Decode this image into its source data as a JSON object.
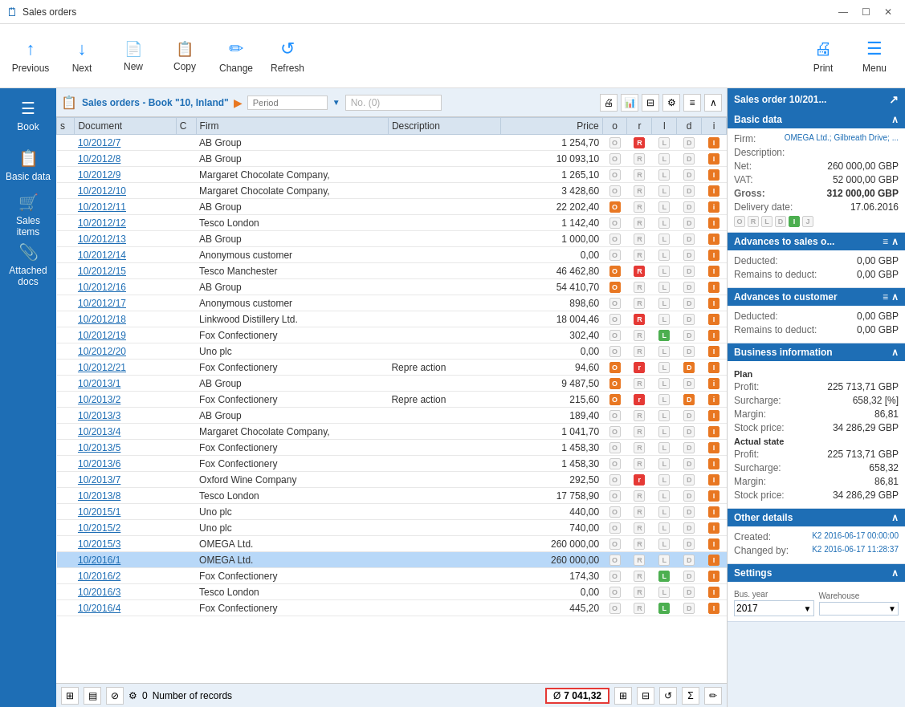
{
  "titleBar": {
    "title": "Sales orders",
    "controls": [
      "minimize",
      "maximize",
      "close"
    ]
  },
  "toolbar": {
    "buttons": [
      {
        "id": "previous",
        "label": "Previous",
        "icon": "↑"
      },
      {
        "id": "next",
        "label": "Next",
        "icon": "↓"
      },
      {
        "id": "new",
        "label": "New",
        "icon": "📄"
      },
      {
        "id": "copy",
        "label": "Copy",
        "icon": "📋"
      },
      {
        "id": "change",
        "label": "Change",
        "icon": "✏"
      },
      {
        "id": "refresh",
        "label": "Refresh",
        "icon": "↺"
      }
    ],
    "rightButtons": [
      {
        "id": "print",
        "label": "Print",
        "icon": "🖨"
      },
      {
        "id": "menu",
        "label": "Menu",
        "icon": "☰"
      }
    ]
  },
  "sidebar": {
    "items": [
      {
        "id": "book",
        "label": "Book",
        "icon": "☰"
      },
      {
        "id": "basic-data",
        "label": "Basic data",
        "icon": "📋"
      },
      {
        "id": "sales-items",
        "label": "Sales items",
        "icon": "🛒"
      },
      {
        "id": "attached-docs",
        "label": "Attached docs",
        "icon": "📎"
      }
    ]
  },
  "tableHeader": {
    "title": "Sales orders - Book \"10, Inland\"",
    "periodPlaceholder": "Period",
    "noLabel": "No. (0)"
  },
  "tableColumns": [
    "s",
    "Document",
    "C",
    "Firm",
    "Description",
    "Price",
    "o",
    "r",
    "l",
    "d",
    "i"
  ],
  "tableRows": [
    {
      "doc": "10/2012/7",
      "firm": "AB Group",
      "desc": "",
      "price": "1 254,70",
      "o": "gray",
      "r": "red",
      "l": "gray",
      "d": "gray",
      "i": "orange",
      "selected": false
    },
    {
      "doc": "10/2012/8",
      "firm": "AB Group",
      "desc": "",
      "price": "10 093,10",
      "o": "gray",
      "r": "gray",
      "l": "gray",
      "d": "gray",
      "i": "orange",
      "selected": false
    },
    {
      "doc": "10/2012/9",
      "firm": "Margaret Chocolate Company,",
      "desc": "",
      "price": "1 265,10",
      "o": "gray",
      "r": "gray",
      "l": "gray",
      "d": "gray",
      "i": "orange",
      "selected": false
    },
    {
      "doc": "10/2012/10",
      "firm": "Margaret Chocolate Company,",
      "desc": "",
      "price": "3 428,60",
      "o": "gray",
      "r": "gray",
      "l": "gray",
      "d": "gray",
      "i": "orange",
      "selected": false
    },
    {
      "doc": "10/2012/11",
      "firm": "AB Group",
      "desc": "",
      "price": "22 202,40",
      "o": "orange",
      "r": "gray",
      "l": "gray",
      "d": "gray",
      "i": "orange-small",
      "selected": false
    },
    {
      "doc": "10/2012/12",
      "firm": "Tesco London",
      "desc": "",
      "price": "1 142,40",
      "o": "gray",
      "r": "gray",
      "l": "gray",
      "d": "gray",
      "i": "orange",
      "selected": false
    },
    {
      "doc": "10/2012/13",
      "firm": "AB Group",
      "desc": "",
      "price": "1 000,00",
      "o": "gray",
      "r": "gray",
      "l": "gray",
      "d": "gray",
      "i": "orange",
      "selected": false
    },
    {
      "doc": "10/2012/14",
      "firm": "Anonymous customer",
      "desc": "",
      "price": "0,00",
      "o": "gray",
      "r": "gray",
      "l": "gray",
      "d": "gray",
      "i": "orange",
      "selected": false
    },
    {
      "doc": "10/2012/15",
      "firm": "Tesco Manchester",
      "desc": "",
      "price": "46 462,80",
      "o": "orange",
      "r": "red",
      "l": "gray-d",
      "d": "gray",
      "i": "orange",
      "selected": false
    },
    {
      "doc": "10/2012/16",
      "firm": "AB Group",
      "desc": "",
      "price": "54 410,70",
      "o": "orange",
      "r": "gray",
      "l": "gray-d",
      "d": "gray",
      "i": "orange",
      "selected": false
    },
    {
      "doc": "10/2012/17",
      "firm": "Anonymous customer",
      "desc": "",
      "price": "898,60",
      "o": "gray",
      "r": "gray",
      "l": "gray",
      "d": "gray",
      "i": "orange",
      "selected": false
    },
    {
      "doc": "10/2012/18",
      "firm": "Linkwood Distillery Ltd.",
      "desc": "",
      "price": "18 004,46",
      "o": "gray",
      "r": "red",
      "l": "gray",
      "d": "gray",
      "i": "orange",
      "selected": false
    },
    {
      "doc": "10/2012/19",
      "firm": "Fox Confectionery",
      "desc": "",
      "price": "302,40",
      "o": "gray",
      "r": "gray",
      "l": "green",
      "d": "gray",
      "i": "orange",
      "selected": false
    },
    {
      "doc": "10/2012/20",
      "firm": "Uno plc",
      "desc": "",
      "price": "0,00",
      "o": "gray",
      "r": "gray",
      "l": "gray",
      "d": "gray",
      "i": "orange",
      "selected": false
    },
    {
      "doc": "10/2012/21",
      "firm": "Fox Confectionery",
      "desc": "Repre action",
      "price": "94,60",
      "o": "orange",
      "r": "red-s",
      "l": "gray",
      "d": "orange-D",
      "i": "orange",
      "selected": false
    },
    {
      "doc": "10/2013/1",
      "firm": "AB Group",
      "desc": "",
      "price": "9 487,50",
      "o": "orange",
      "r": "gray",
      "l": "gray",
      "d": "gray",
      "i": "orange-small",
      "selected": false
    },
    {
      "doc": "10/2013/2",
      "firm": "Fox Confectionery",
      "desc": "Repre action",
      "price": "215,60",
      "o": "orange",
      "r": "red-s",
      "l": "gray",
      "d": "orange-D",
      "i": "orange-small",
      "selected": false
    },
    {
      "doc": "10/2013/3",
      "firm": "AB Group",
      "desc": "",
      "price": "189,40",
      "o": "gray",
      "r": "gray",
      "l": "gray",
      "d": "gray",
      "i": "orange",
      "selected": false
    },
    {
      "doc": "10/2013/4",
      "firm": "Margaret Chocolate Company,",
      "desc": "",
      "price": "1 041,70",
      "o": "gray",
      "r": "gray",
      "l": "gray",
      "d": "gray",
      "i": "orange",
      "selected": false
    },
    {
      "doc": "10/2013/5",
      "firm": "Fox Confectionery",
      "desc": "",
      "price": "1 458,30",
      "o": "gray",
      "r": "gray",
      "l": "gray",
      "d": "gray",
      "i": "orange",
      "selected": false
    },
    {
      "doc": "10/2013/6",
      "firm": "Fox Confectionery",
      "desc": "",
      "price": "1 458,30",
      "o": "gray",
      "r": "gray",
      "l": "gray",
      "d": "gray",
      "i": "orange",
      "selected": false
    },
    {
      "doc": "10/2013/7",
      "firm": "Oxford Wine Company",
      "desc": "",
      "price": "292,50",
      "o": "gray",
      "r": "red-s",
      "l": "gray",
      "d": "gray",
      "i": "orange",
      "selected": false
    },
    {
      "doc": "10/2013/8",
      "firm": "Tesco London",
      "desc": "",
      "price": "17 758,90",
      "o": "gray",
      "r": "gray",
      "l": "gray",
      "d": "gray",
      "i": "orange",
      "selected": false
    },
    {
      "doc": "10/2015/1",
      "firm": "Uno plc",
      "desc": "",
      "price": "440,00",
      "o": "gray",
      "r": "gray",
      "l": "gray",
      "d": "gray",
      "i": "orange",
      "selected": false
    },
    {
      "doc": "10/2015/2",
      "firm": "Uno plc",
      "desc": "",
      "price": "740,00",
      "o": "gray",
      "r": "gray",
      "l": "gray",
      "d": "gray",
      "i": "orange",
      "selected": false
    },
    {
      "doc": "10/2015/3",
      "firm": "OMEGA Ltd.",
      "desc": "",
      "price": "260 000,00",
      "o": "gray",
      "r": "gray",
      "l": "gray",
      "d": "gray",
      "i": "orange",
      "selected": false
    },
    {
      "doc": "10/2016/1",
      "firm": "OMEGA Ltd.",
      "desc": "",
      "price": "260 000,00",
      "o": "gray",
      "r": "gray",
      "l": "gray",
      "d": "gray",
      "i": "orange",
      "selected": true
    },
    {
      "doc": "10/2016/2",
      "firm": "Fox Confectionery",
      "desc": "",
      "price": "174,30",
      "o": "gray",
      "r": "gray",
      "l": "green",
      "d": "gray",
      "i": "orange",
      "selected": false
    },
    {
      "doc": "10/2016/3",
      "firm": "Tesco London",
      "desc": "",
      "price": "0,00",
      "o": "gray",
      "r": "gray",
      "l": "gray",
      "d": "gray",
      "i": "orange",
      "selected": false
    },
    {
      "doc": "10/2016/4",
      "firm": "Fox Confectionery",
      "desc": "",
      "price": "445,20",
      "o": "gray",
      "r": "gray",
      "l": "green",
      "d": "gray",
      "i": "orange",
      "selected": false
    }
  ],
  "bottomBar": {
    "avgSymbol": "Ø",
    "avgValue": "7 041,32",
    "recordsLabel": "Number of records"
  },
  "rightPanel": {
    "title": "Sales order 10/201...",
    "sections": {
      "basicData": {
        "label": "Basic data",
        "firm": "OMEGA Ltd.; Gilbreath Drive; ...",
        "description": "",
        "net": "260 000,00 GBP",
        "vat": "52 000,00 GBP",
        "gross": "312 000,00 GBP",
        "deliveryDate": "17.06.2016",
        "statusBtns": [
          "O",
          "R",
          "L",
          "D",
          "I",
          "J"
        ]
      },
      "advances": {
        "label": "Advances to sales o...",
        "deducted": "0,00 GBP",
        "remainsToDeduct": "0,00 GBP"
      },
      "advancesToCustomer": {
        "label": "Advances to customer",
        "deducted": "0,00 GBP",
        "remainsToDeduct": "0,00 GBP"
      },
      "businessInfo": {
        "label": "Business information",
        "planTitle": "Plan",
        "profit": "225 713,71 GBP",
        "surcharge": "658,32 [%]",
        "margin": "86,81",
        "stockPrice": "34 286,29 GBP",
        "actualTitle": "Actual state",
        "actualProfit": "225 713,71 GBP",
        "actualSurcharge": "658,32",
        "actualMargin": "86,81",
        "actualStockPrice": "34 286,29 GBP"
      },
      "otherDetails": {
        "label": "Other details",
        "createdLabel": "Created:",
        "createdValue": "K2 2016-06-17 00:00:00",
        "changedByLabel": "Changed by:",
        "changedByValue": "K2 2016-06-17 11:28:37"
      },
      "settings": {
        "label": "Settings",
        "busYearLabel": "Bus. year",
        "busYearValue": "2017",
        "warehouseLabel": "Warehouse",
        "warehouseValue": ""
      }
    }
  }
}
